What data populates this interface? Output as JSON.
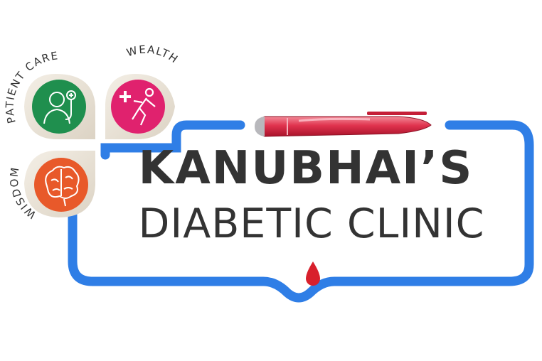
{
  "logo": {
    "title_line1": "KANUBHAI’S",
    "title_line2": "DIABETIC CLINIC",
    "badges": [
      {
        "label": "PATIENT CARE",
        "icon": "doctor-icon",
        "color": "#1f8f4e"
      },
      {
        "label": "WEALTH",
        "icon": "running-health-icon",
        "color": "#e0226e"
      },
      {
        "label": "WISDOM",
        "icon": "brain-icon",
        "color": "#e8592a"
      }
    ],
    "colors": {
      "frame": "#2f7ee6",
      "text": "#333333",
      "pen": "#d9243f",
      "blood_drop": "#d8202c"
    }
  }
}
